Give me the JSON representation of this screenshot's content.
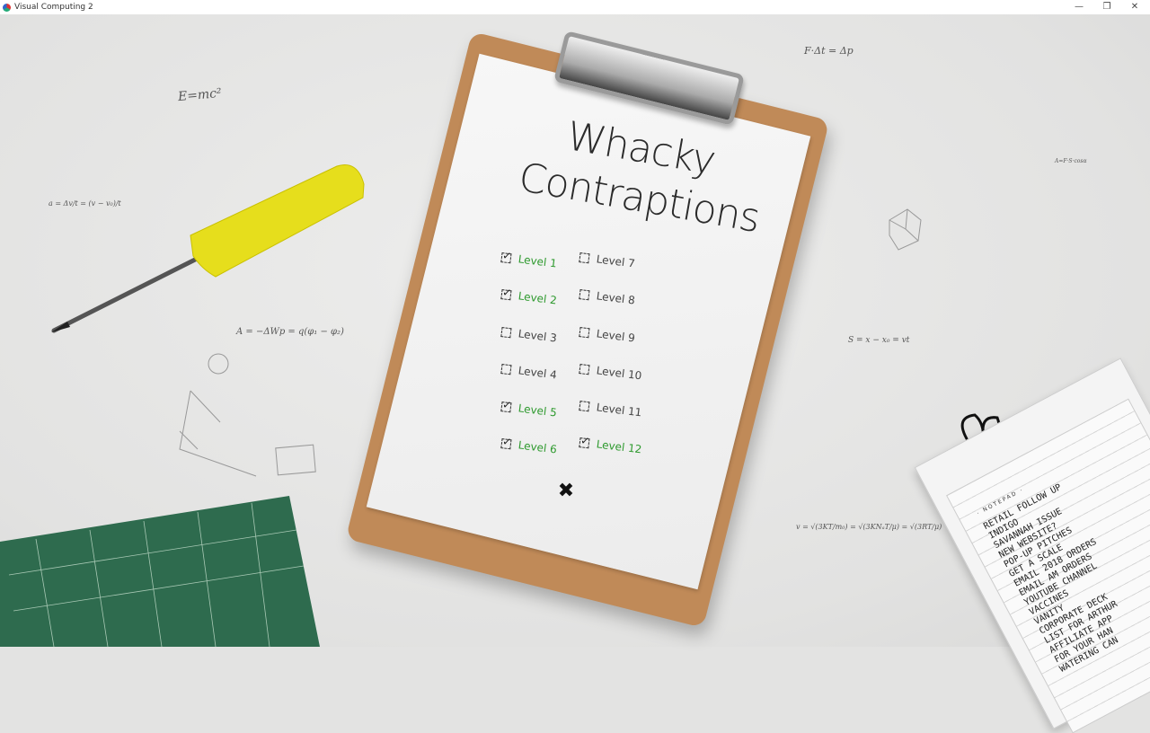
{
  "window": {
    "title": "Visual Computing 2",
    "minimize": "—",
    "maximize": "❐",
    "close": "✕"
  },
  "game": {
    "title_line1": "Whacky",
    "title_line2": "Contraptions",
    "levels": [
      {
        "label": "Level 1",
        "completed": true
      },
      {
        "label": "Level 2",
        "completed": true
      },
      {
        "label": "Level 3",
        "completed": false
      },
      {
        "label": "Level 4",
        "completed": false
      },
      {
        "label": "Level 5",
        "completed": true
      },
      {
        "label": "Level 6",
        "completed": true
      },
      {
        "label": "Level 7",
        "completed": false
      },
      {
        "label": "Level 8",
        "completed": false
      },
      {
        "label": "Level 9",
        "completed": false
      },
      {
        "label": "Level 10",
        "completed": false
      },
      {
        "label": "Level 11",
        "completed": false
      },
      {
        "label": "Level 12",
        "completed": true
      }
    ],
    "check_glyph": "✓",
    "close_glyph": "✖",
    "completed_color": "#2f9a2f",
    "incomplete_color": "#444444"
  },
  "background": {
    "formulas": [
      "E=mc²",
      "a = Δv/t = (v − v₀)/t",
      "A = −ΔWp = q(φ₁ − φ₂)",
      "F·Δt = Δp",
      "A=F·S·cosα",
      "S = x − x₀ = vt",
      "v = √(3KT/m₀) = √(3KNₐT/μ) = √(3RT/μ)"
    ],
    "notepad": {
      "heading": "· NOTEPAD ·",
      "items": [
        "RETAIL FOLLOW UP",
        "INDIGO",
        "SAVANNAH ISSUE",
        "NEW WEBSITE?",
        "POP-UP PITCHES",
        "GET A SCALE",
        "EMAIL 2018 ORDERS",
        "EMAIL AM ORDERS",
        "YOUTUBE CHANNEL",
        "VACCINES",
        "VANITY",
        "CORPORATE DECK",
        "LIST FOR ARTHUR",
        "AFFILIATE APP",
        "FOR YOUR HAN",
        "WATERING CAN"
      ]
    }
  }
}
